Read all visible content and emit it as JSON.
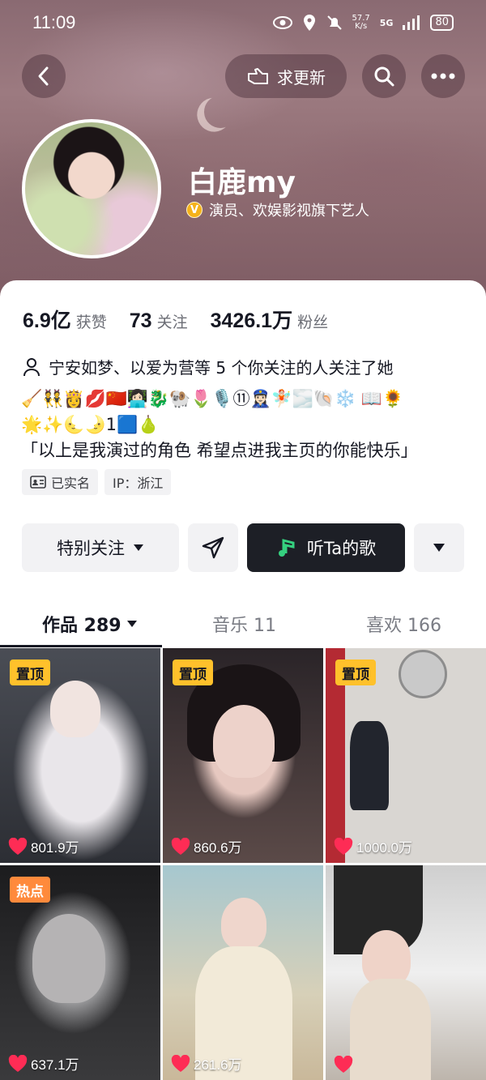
{
  "status_bar": {
    "time": "11:09",
    "net_speed_top": "57.7",
    "net_speed_bottom": "K/s",
    "network": "5G",
    "battery": "80"
  },
  "top_bar": {
    "update_request_label": "求更新"
  },
  "profile": {
    "name": "白鹿my",
    "verified_badge": "V",
    "verification": "演员、欢娱影视旗下艺人",
    "stats": [
      {
        "value": "6.9亿",
        "label": "获赞"
      },
      {
        "value": "73",
        "label": "关注"
      },
      {
        "value": "3426.1万",
        "label": "粉丝"
      }
    ],
    "mutual_friends": "宁安如梦、以爱为营等 5 个你关注的人关注了她",
    "bio_emoji_line1": "🧹👯👸💋🇨🇳👩🏻‍💻🐉🐏🌷🎙️⑪👮🏻‍♀️🧚🏻🌫️🐚❄️ 📖🌻",
    "bio_emoji_line2": "🌟✨🌜🌛1🟦🍐",
    "bio_quote": "「以上是我演过的角色 希望点进我主页的你能快乐」",
    "tags": [
      {
        "icon": "id-card-icon",
        "text": "已实名"
      },
      {
        "icon": "",
        "text": "IP：浙江"
      }
    ]
  },
  "actions": {
    "follow_label": "特别关注",
    "song_label": "听Ta的歌"
  },
  "tabs": {
    "works": "作品 289",
    "music": "音乐 11",
    "likes": "喜欢 166"
  },
  "grid": [
    {
      "badge": "置顶",
      "badge_type": "pin",
      "likes": "801.9万"
    },
    {
      "badge": "置顶",
      "badge_type": "pin",
      "likes": "860.6万"
    },
    {
      "badge": "置顶",
      "badge_type": "pin",
      "likes": "1000.0万"
    },
    {
      "badge": "热点",
      "badge_type": "hot",
      "likes": "637.1万"
    },
    {
      "badge": "",
      "badge_type": "",
      "likes": "261.6万"
    },
    {
      "badge": "",
      "badge_type": "",
      "likes": ""
    }
  ],
  "colors": {
    "pin_badge": "#ffc12b",
    "hot_badge": "#ff8a3c",
    "like_heart": "#fe2c55",
    "song_button": "#1d1f26",
    "verify_badge": "#f5b21a"
  }
}
